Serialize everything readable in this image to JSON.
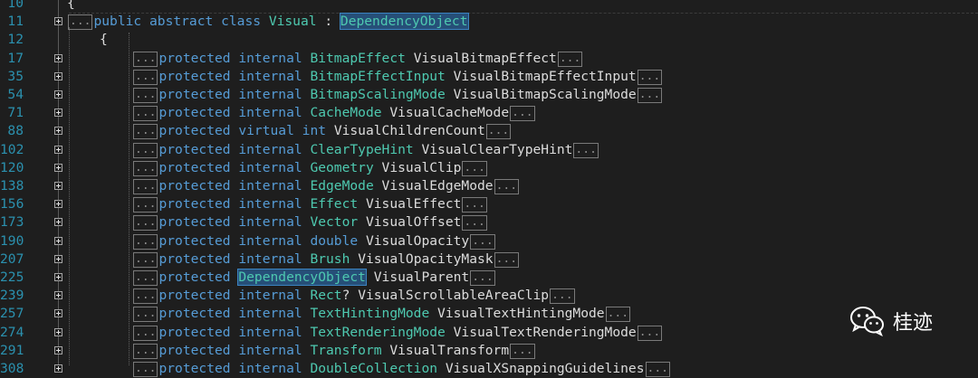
{
  "editor": {
    "lines": [
      {
        "n": "10",
        "fold": false,
        "indent": 0,
        "tokens": [
          {
            "t": "p",
            "v": "{"
          }
        ]
      },
      {
        "n": "11",
        "fold": true,
        "indent": 0,
        "tokens": [
          {
            "t": "c",
            "v": "..."
          },
          {
            "t": "kw",
            "v": "public"
          },
          {
            "t": "p",
            "v": " "
          },
          {
            "t": "kw",
            "v": "abstract"
          },
          {
            "t": "p",
            "v": " "
          },
          {
            "t": "kw",
            "v": "class"
          },
          {
            "t": "p",
            "v": " "
          },
          {
            "t": "ty",
            "v": "Visual"
          },
          {
            "t": "p",
            "v": " : "
          },
          {
            "t": "hl",
            "v": "DependencyObject"
          }
        ]
      },
      {
        "n": "12",
        "fold": false,
        "indent": 1,
        "tokens": [
          {
            "t": "p",
            "v": "{"
          }
        ]
      },
      {
        "n": "17",
        "fold": true,
        "indent": 2,
        "tokens": [
          {
            "t": "c",
            "v": "..."
          },
          {
            "t": "kw",
            "v": "protected"
          },
          {
            "t": "p",
            "v": " "
          },
          {
            "t": "kw",
            "v": "internal"
          },
          {
            "t": "p",
            "v": " "
          },
          {
            "t": "ty",
            "v": "BitmapEffect"
          },
          {
            "t": "p",
            "v": " "
          },
          {
            "t": "id",
            "v": "VisualBitmapEffect"
          },
          {
            "t": "c",
            "v": "..."
          }
        ]
      },
      {
        "n": "35",
        "fold": true,
        "indent": 2,
        "tokens": [
          {
            "t": "c",
            "v": "..."
          },
          {
            "t": "kw",
            "v": "protected"
          },
          {
            "t": "p",
            "v": " "
          },
          {
            "t": "kw",
            "v": "internal"
          },
          {
            "t": "p",
            "v": " "
          },
          {
            "t": "ty",
            "v": "BitmapEffectInput"
          },
          {
            "t": "p",
            "v": " "
          },
          {
            "t": "id",
            "v": "VisualBitmapEffectInput"
          },
          {
            "t": "c",
            "v": "..."
          }
        ]
      },
      {
        "n": "54",
        "fold": true,
        "indent": 2,
        "tokens": [
          {
            "t": "c",
            "v": "..."
          },
          {
            "t": "kw",
            "v": "protected"
          },
          {
            "t": "p",
            "v": " "
          },
          {
            "t": "kw",
            "v": "internal"
          },
          {
            "t": "p",
            "v": " "
          },
          {
            "t": "ty",
            "v": "BitmapScalingMode"
          },
          {
            "t": "p",
            "v": " "
          },
          {
            "t": "id",
            "v": "VisualBitmapScalingMode"
          },
          {
            "t": "c",
            "v": "..."
          }
        ]
      },
      {
        "n": "71",
        "fold": true,
        "indent": 2,
        "tokens": [
          {
            "t": "c",
            "v": "..."
          },
          {
            "t": "kw",
            "v": "protected"
          },
          {
            "t": "p",
            "v": " "
          },
          {
            "t": "kw",
            "v": "internal"
          },
          {
            "t": "p",
            "v": " "
          },
          {
            "t": "ty",
            "v": "CacheMode"
          },
          {
            "t": "p",
            "v": " "
          },
          {
            "t": "id",
            "v": "VisualCacheMode"
          },
          {
            "t": "c",
            "v": "..."
          }
        ]
      },
      {
        "n": "88",
        "fold": true,
        "indent": 2,
        "tokens": [
          {
            "t": "c",
            "v": "..."
          },
          {
            "t": "kw",
            "v": "protected"
          },
          {
            "t": "p",
            "v": " "
          },
          {
            "t": "kw",
            "v": "virtual"
          },
          {
            "t": "p",
            "v": " "
          },
          {
            "t": "kw",
            "v": "int"
          },
          {
            "t": "p",
            "v": " "
          },
          {
            "t": "id",
            "v": "VisualChildrenCount"
          },
          {
            "t": "c",
            "v": "..."
          }
        ]
      },
      {
        "n": "102",
        "fold": true,
        "indent": 2,
        "tokens": [
          {
            "t": "c",
            "v": "..."
          },
          {
            "t": "kw",
            "v": "protected"
          },
          {
            "t": "p",
            "v": " "
          },
          {
            "t": "kw",
            "v": "internal"
          },
          {
            "t": "p",
            "v": " "
          },
          {
            "t": "ty",
            "v": "ClearTypeHint"
          },
          {
            "t": "p",
            "v": " "
          },
          {
            "t": "id",
            "v": "VisualClearTypeHint"
          },
          {
            "t": "c",
            "v": "..."
          }
        ]
      },
      {
        "n": "120",
        "fold": true,
        "indent": 2,
        "tokens": [
          {
            "t": "c",
            "v": "..."
          },
          {
            "t": "kw",
            "v": "protected"
          },
          {
            "t": "p",
            "v": " "
          },
          {
            "t": "kw",
            "v": "internal"
          },
          {
            "t": "p",
            "v": " "
          },
          {
            "t": "ty",
            "v": "Geometry"
          },
          {
            "t": "p",
            "v": " "
          },
          {
            "t": "id",
            "v": "VisualClip"
          },
          {
            "t": "c",
            "v": "..."
          }
        ]
      },
      {
        "n": "138",
        "fold": true,
        "indent": 2,
        "tokens": [
          {
            "t": "c",
            "v": "..."
          },
          {
            "t": "kw",
            "v": "protected"
          },
          {
            "t": "p",
            "v": " "
          },
          {
            "t": "kw",
            "v": "internal"
          },
          {
            "t": "p",
            "v": " "
          },
          {
            "t": "ty",
            "v": "EdgeMode"
          },
          {
            "t": "p",
            "v": " "
          },
          {
            "t": "id",
            "v": "VisualEdgeMode"
          },
          {
            "t": "c",
            "v": "..."
          }
        ]
      },
      {
        "n": "156",
        "fold": true,
        "indent": 2,
        "tokens": [
          {
            "t": "c",
            "v": "..."
          },
          {
            "t": "kw",
            "v": "protected"
          },
          {
            "t": "p",
            "v": " "
          },
          {
            "t": "kw",
            "v": "internal"
          },
          {
            "t": "p",
            "v": " "
          },
          {
            "t": "ty",
            "v": "Effect"
          },
          {
            "t": "p",
            "v": " "
          },
          {
            "t": "id",
            "v": "VisualEffect"
          },
          {
            "t": "c",
            "v": "..."
          }
        ]
      },
      {
        "n": "173",
        "fold": true,
        "indent": 2,
        "tokens": [
          {
            "t": "c",
            "v": "..."
          },
          {
            "t": "kw",
            "v": "protected"
          },
          {
            "t": "p",
            "v": " "
          },
          {
            "t": "kw",
            "v": "internal"
          },
          {
            "t": "p",
            "v": " "
          },
          {
            "t": "ty",
            "v": "Vector"
          },
          {
            "t": "p",
            "v": " "
          },
          {
            "t": "id",
            "v": "VisualOffset"
          },
          {
            "t": "c",
            "v": "..."
          }
        ]
      },
      {
        "n": "190",
        "fold": true,
        "indent": 2,
        "tokens": [
          {
            "t": "c",
            "v": "..."
          },
          {
            "t": "kw",
            "v": "protected"
          },
          {
            "t": "p",
            "v": " "
          },
          {
            "t": "kw",
            "v": "internal"
          },
          {
            "t": "p",
            "v": " "
          },
          {
            "t": "kw",
            "v": "double"
          },
          {
            "t": "p",
            "v": " "
          },
          {
            "t": "id",
            "v": "VisualOpacity"
          },
          {
            "t": "c",
            "v": "..."
          }
        ]
      },
      {
        "n": "207",
        "fold": true,
        "indent": 2,
        "tokens": [
          {
            "t": "c",
            "v": "..."
          },
          {
            "t": "kw",
            "v": "protected"
          },
          {
            "t": "p",
            "v": " "
          },
          {
            "t": "kw",
            "v": "internal"
          },
          {
            "t": "p",
            "v": " "
          },
          {
            "t": "ty",
            "v": "Brush"
          },
          {
            "t": "p",
            "v": " "
          },
          {
            "t": "id",
            "v": "VisualOpacityMask"
          },
          {
            "t": "c",
            "v": "..."
          }
        ]
      },
      {
        "n": "225",
        "fold": true,
        "indent": 2,
        "tokens": [
          {
            "t": "c",
            "v": "..."
          },
          {
            "t": "kw",
            "v": "protected"
          },
          {
            "t": "p",
            "v": " "
          },
          {
            "t": "hl",
            "v": "DependencyObject"
          },
          {
            "t": "p",
            "v": " "
          },
          {
            "t": "id",
            "v": "VisualParent"
          },
          {
            "t": "c",
            "v": "..."
          }
        ]
      },
      {
        "n": "239",
        "fold": true,
        "indent": 2,
        "tokens": [
          {
            "t": "c",
            "v": "..."
          },
          {
            "t": "kw",
            "v": "protected"
          },
          {
            "t": "p",
            "v": " "
          },
          {
            "t": "kw",
            "v": "internal"
          },
          {
            "t": "p",
            "v": " "
          },
          {
            "t": "ty",
            "v": "Rect"
          },
          {
            "t": "p",
            "v": "? "
          },
          {
            "t": "id",
            "v": "VisualScrollableAreaClip"
          },
          {
            "t": "c",
            "v": "..."
          }
        ]
      },
      {
        "n": "257",
        "fold": true,
        "indent": 2,
        "tokens": [
          {
            "t": "c",
            "v": "..."
          },
          {
            "t": "kw",
            "v": "protected"
          },
          {
            "t": "p",
            "v": " "
          },
          {
            "t": "kw",
            "v": "internal"
          },
          {
            "t": "p",
            "v": " "
          },
          {
            "t": "ty",
            "v": "TextHintingMode"
          },
          {
            "t": "p",
            "v": " "
          },
          {
            "t": "id",
            "v": "VisualTextHintingMode"
          },
          {
            "t": "c",
            "v": "..."
          }
        ]
      },
      {
        "n": "274",
        "fold": true,
        "indent": 2,
        "tokens": [
          {
            "t": "c",
            "v": "..."
          },
          {
            "t": "kw",
            "v": "protected"
          },
          {
            "t": "p",
            "v": " "
          },
          {
            "t": "kw",
            "v": "internal"
          },
          {
            "t": "p",
            "v": " "
          },
          {
            "t": "ty",
            "v": "TextRenderingMode"
          },
          {
            "t": "p",
            "v": " "
          },
          {
            "t": "id",
            "v": "VisualTextRenderingMode"
          },
          {
            "t": "c",
            "v": "..."
          }
        ]
      },
      {
        "n": "291",
        "fold": true,
        "indent": 2,
        "tokens": [
          {
            "t": "c",
            "v": "..."
          },
          {
            "t": "kw",
            "v": "protected"
          },
          {
            "t": "p",
            "v": " "
          },
          {
            "t": "kw",
            "v": "internal"
          },
          {
            "t": "p",
            "v": " "
          },
          {
            "t": "ty",
            "v": "Transform"
          },
          {
            "t": "p",
            "v": " "
          },
          {
            "t": "id",
            "v": "VisualTransform"
          },
          {
            "t": "c",
            "v": "..."
          }
        ]
      },
      {
        "n": "308",
        "fold": true,
        "indent": 2,
        "tokens": [
          {
            "t": "c",
            "v": "..."
          },
          {
            "t": "kw",
            "v": "protected"
          },
          {
            "t": "p",
            "v": " "
          },
          {
            "t": "kw",
            "v": "internal"
          },
          {
            "t": "p",
            "v": " "
          },
          {
            "t": "ty",
            "v": "DoubleCollection"
          },
          {
            "t": "p",
            "v": " "
          },
          {
            "t": "id",
            "v": "VisualXSnappingGuidelines"
          },
          {
            "t": "c",
            "v": "..."
          }
        ]
      }
    ]
  },
  "watermark": {
    "icon": "wechat-icon",
    "text": "桂迹"
  },
  "colors": {
    "keyword": "#569cd6",
    "type": "#4ec9b0",
    "lineNumber": "#2b91af",
    "background": "#1e1e1e"
  }
}
